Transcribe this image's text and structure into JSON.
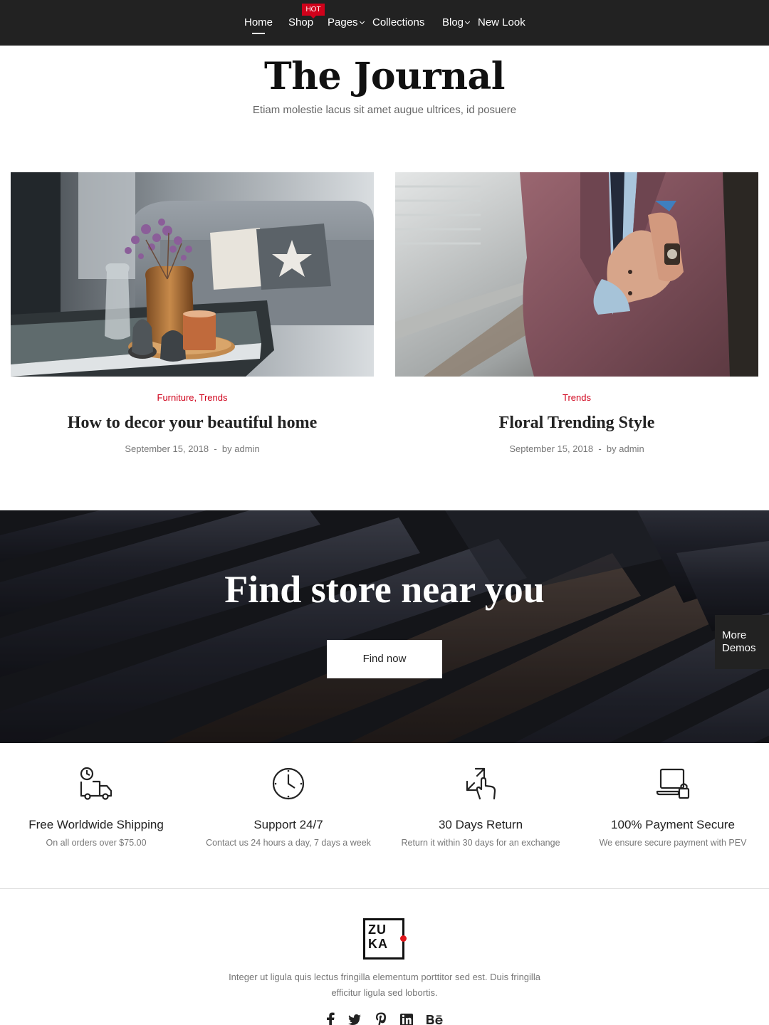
{
  "nav": {
    "items": [
      {
        "label": "Home",
        "active": true
      },
      {
        "label": "Shop",
        "badge": "HOT"
      },
      {
        "label": "Pages",
        "dropdown": true
      },
      {
        "label": "Collections"
      },
      {
        "label": "Blog",
        "dropdown": true
      },
      {
        "label": "New Look"
      }
    ]
  },
  "journal": {
    "title": "The Journal",
    "subtitle": "Etiam molestie lacus sit amet augue ultrices, id posuere"
  },
  "posts": [
    {
      "category": "Furniture, Trends",
      "title": "How to decor your beautiful home",
      "date": "September 15, 2018",
      "author": "by admin"
    },
    {
      "category": "Trends",
      "title": "Floral Trending Style",
      "date": "September 15, 2018",
      "author": "by admin"
    }
  ],
  "banner": {
    "title": "Find store near you",
    "button_label": "Find now"
  },
  "more_demos": {
    "line1": "More",
    "line2": "Demos"
  },
  "features": [
    {
      "icon": "truck-clock-icon",
      "title": "Free Worldwide Shipping",
      "description": "On all orders over $75.00"
    },
    {
      "icon": "clock-icon",
      "title": "Support 24/7",
      "description": "Contact us 24 hours a day, 7 days a week"
    },
    {
      "icon": "return-hand-icon",
      "title": "30 Days Return",
      "description": "Return it within 30 days for an exchange"
    },
    {
      "icon": "laptop-lock-icon",
      "title": "100% Payment Secure",
      "description": "We ensure secure payment with PEV"
    }
  ],
  "footer": {
    "logo_line1": "ZU",
    "logo_line2": "KA",
    "description": "Integer ut ligula quis lectus fringilla elementum porttitor sed est. Duis fringilla efficitur ligula sed lobortis.",
    "social": [
      "facebook-icon",
      "twitter-icon",
      "pinterest-icon",
      "linkedin-icon",
      "behance-icon"
    ]
  },
  "colors": {
    "nav_bg": "#222222",
    "accent": "#d0021b",
    "text": "#222222",
    "muted": "#777777"
  }
}
